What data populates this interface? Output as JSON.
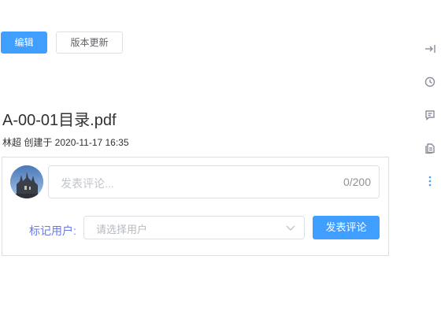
{
  "toolbar": {
    "edit_label": "编辑",
    "version_update_label": "版本更新"
  },
  "side_icons": [
    "collapse-right-icon",
    "clock-icon",
    "comment-icon",
    "document-icon",
    "more-vertical-icon"
  ],
  "document": {
    "title": "A-00-01目录.pdf",
    "meta": "林超 创建于 2020-11-17 16:35"
  },
  "comment": {
    "placeholder": "发表评论...",
    "counter": "0/200",
    "mark_user_label": "标记用户:",
    "select_placeholder": "请选择用户",
    "submit_label": "发表评论"
  },
  "colors": {
    "primary": "#409eff",
    "label_accent": "#6a7be0",
    "icon_gray": "#8a8f99"
  }
}
